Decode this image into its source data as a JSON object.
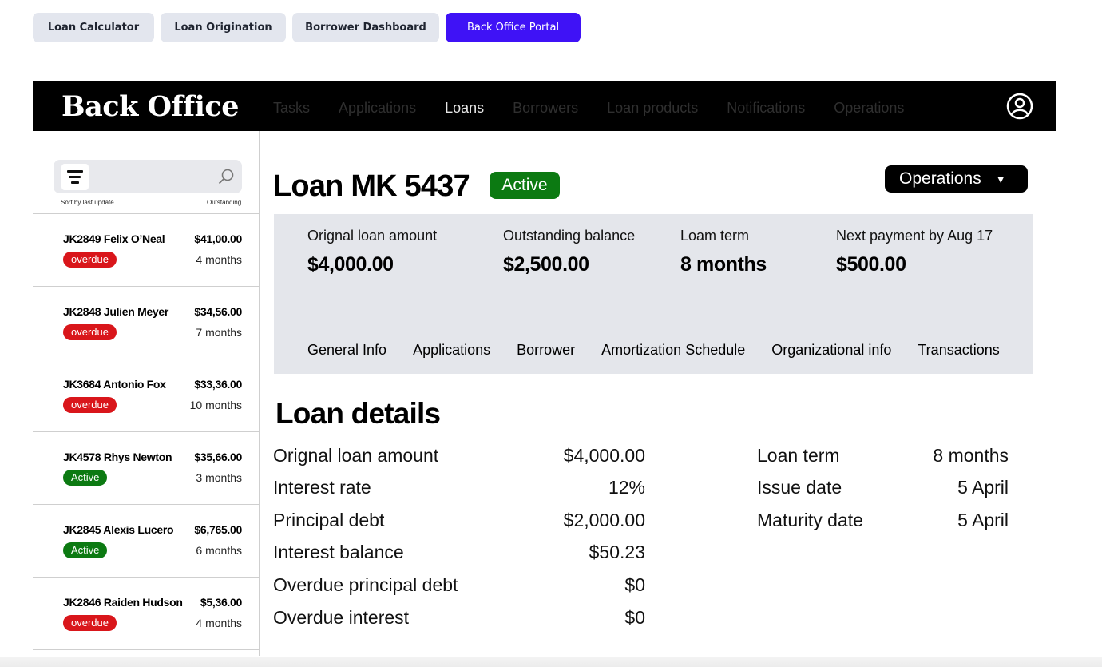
{
  "portal_tabs": [
    {
      "label": "Loan Calculator"
    },
    {
      "label": "Loan Origination"
    },
    {
      "label": "Borrower Dashboard"
    },
    {
      "label": "Back Office Portal"
    }
  ],
  "header": {
    "brand": "Back Office",
    "nav": [
      "Tasks",
      "Applications",
      "Loans",
      "Borrowers",
      "Loan products",
      "Notifications",
      "Operations"
    ],
    "active_nav": "Loans"
  },
  "sidebar": {
    "sort_label": "Sort by last update",
    "outstanding_label": "Outstanding",
    "loans": [
      {
        "title": "JK2849  Felix O’Neal",
        "amount": "$41,00.00",
        "months": "4 months",
        "status": "overdue"
      },
      {
        "title": "JK2848  Julien Meyer",
        "amount": "$34,56.00",
        "months": "7 months",
        "status": "overdue"
      },
      {
        "title": "JK3684 Antonio Fox",
        "amount": "$33,36.00",
        "months": "10 months",
        "status": "overdue"
      },
      {
        "title": "JK4578 Rhys Newton",
        "amount": "$35,66.00",
        "months": "3 months",
        "status": "Active"
      },
      {
        "title": "JK2845  Alexis Lucero",
        "amount": "$6,765.00",
        "months": "6 months",
        "status": "Active"
      },
      {
        "title": "JK2846 Raiden Hudson",
        "amount": "$5,36.00",
        "months": "4 months",
        "status": "overdue"
      }
    ]
  },
  "loan": {
    "title": "Loan MK 5437",
    "status": "Active",
    "operations_label": "Operations",
    "summary": [
      {
        "label": "Orignal loan amount",
        "value": "$4,000.00"
      },
      {
        "label": "Outstanding balance",
        "value": "$2,500.00"
      },
      {
        "label": "Loam term",
        "value": "8 months"
      },
      {
        "label": "Next payment by Aug 17",
        "value": "$500.00"
      }
    ],
    "tabs": [
      "General Info",
      "Applications",
      "Borrower",
      "Amortization Schedule",
      "Organizational info",
      "Transactions"
    ]
  },
  "details": {
    "heading": "Loan details",
    "left": [
      {
        "label": "Orignal loan amount",
        "value": "$4,000.00"
      },
      {
        "label": "Interest rate",
        "value": "12%"
      },
      {
        "label": "Principal debt",
        "value": "$2,000.00"
      },
      {
        "label": "Interest balance",
        "value": "$50.23"
      },
      {
        "label": "Overdue principal debt",
        "value": "$0"
      },
      {
        "label": "Overdue interest",
        "value": "$0"
      }
    ],
    "right": [
      {
        "label": "Loan term",
        "value": "8 months"
      },
      {
        "label": "Issue date",
        "value": "5 April"
      },
      {
        "label": "Maturity date",
        "value": "5 April"
      }
    ]
  },
  "colors": {
    "accent": "#3f12f6",
    "overdue": "#d9161b",
    "active": "#0c7a12",
    "panel": "#e4e6eb"
  },
  "icons": {
    "filter": "filter-lines-icon",
    "search": "search-icon",
    "user": "user-circle-icon",
    "caret": "caret-down-icon"
  }
}
